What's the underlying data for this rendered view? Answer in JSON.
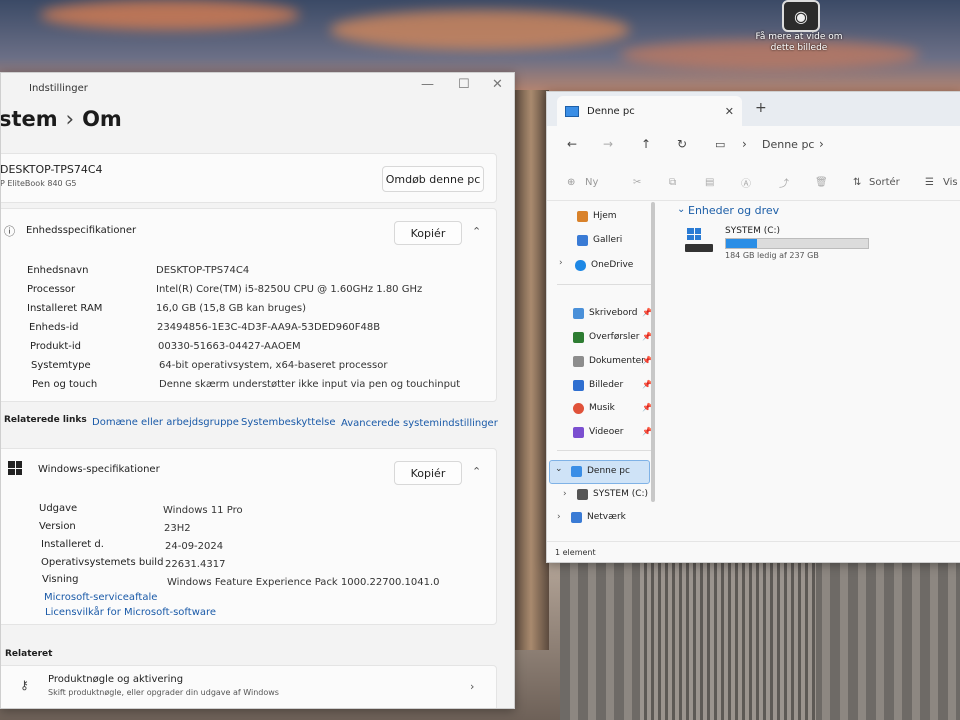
{
  "desktop": {
    "spotlight_caption": "Få mere at vide om dette billede"
  },
  "settings": {
    "window_title": "Indstillinger",
    "breadcrumb": {
      "parent": "stem",
      "separator": "›",
      "current": "Om"
    },
    "device": {
      "name": "DESKTOP-TPS74C4",
      "model": "P EliteBook 840 G5",
      "rename_button": "Omdøb denne pc"
    },
    "device_specs": {
      "title": "Enhedsspecifikationer",
      "copy_button": "Kopiér",
      "rows": [
        {
          "label": "Enhedsnavn",
          "value": "DESKTOP-TPS74C4"
        },
        {
          "label": "Processor",
          "value": "Intel(R) Core(TM) i5-8250U CPU @ 1.60GHz   1.80 GHz"
        },
        {
          "label": "Installeret RAM",
          "value": "16,0 GB (15,8 GB kan bruges)"
        },
        {
          "label": "Enheds-id",
          "value": "23494856-1E3C-4D3F-AA9A-53DED960F48B"
        },
        {
          "label": "Produkt-id",
          "value": "00330-51663-04427-AAOEM"
        },
        {
          "label": "Systemtype",
          "value": "64-bit operativsystem, x64-baseret processor"
        },
        {
          "label": "Pen og touch",
          "value": "Denne skærm understøtter ikke input via pen og touchinput"
        }
      ]
    },
    "related_links": {
      "label": "Relaterede links",
      "links": [
        "Domæne eller arbejdsgruppe",
        "Systembeskyttelse",
        "Avancerede systemindstillinger"
      ]
    },
    "windows_specs": {
      "title": "Windows-specifikationer",
      "copy_button": "Kopiér",
      "rows": [
        {
          "label": "Udgave",
          "value": "Windows 11 Pro"
        },
        {
          "label": "Version",
          "value": "23H2"
        },
        {
          "label": "Installeret d.",
          "value": "24-09-2024"
        },
        {
          "label": "Operativsystemets build",
          "value": "22631.4317"
        },
        {
          "label": "Visning",
          "value": "Windows Feature Experience Pack 1000.22700.1041.0"
        }
      ],
      "links": [
        "Microsoft-serviceaftale",
        "Licensvilkår for Microsoft-software"
      ]
    },
    "related": {
      "label": "Relateret",
      "item_title": "Produktnøgle og aktivering",
      "item_desc": "Skift produktnøgle, eller opgrader din udgave af Windows"
    }
  },
  "explorer": {
    "tab_title": "Denne pc",
    "new_tab": "+",
    "address": {
      "location": "Denne pc"
    },
    "commands": {
      "new": "Ny",
      "sort": "Sortér",
      "view": "Vis"
    },
    "nav": [
      {
        "label": "Hjem",
        "color": "#d9822b"
      },
      {
        "label": "Galleri",
        "color": "#3a7bd5"
      },
      {
        "label": "OneDrive",
        "color": "#1e88e5"
      },
      {
        "label": "Skrivebord",
        "color": "#4a90d9"
      },
      {
        "label": "Overførsler",
        "color": "#2e7d32"
      },
      {
        "label": "Dokumenter",
        "color": "#8d8d8d"
      },
      {
        "label": "Billeder",
        "color": "#2f6fd0"
      },
      {
        "label": "Musik",
        "color": "#e0523a"
      },
      {
        "label": "Videoer",
        "color": "#7b4fd0"
      },
      {
        "label": "Denne pc",
        "color": "#3a8ee6"
      },
      {
        "label": "SYSTEM (C:)",
        "color": "#555555"
      },
      {
        "label": "Netværk",
        "color": "#3a7bd5"
      }
    ],
    "group_title": "Enheder og drev",
    "drive": {
      "name": "SYSTEM (C:)",
      "free_text": "184 GB ledig af 237 GB",
      "used_fraction": 0.22
    },
    "status": "1 element"
  }
}
